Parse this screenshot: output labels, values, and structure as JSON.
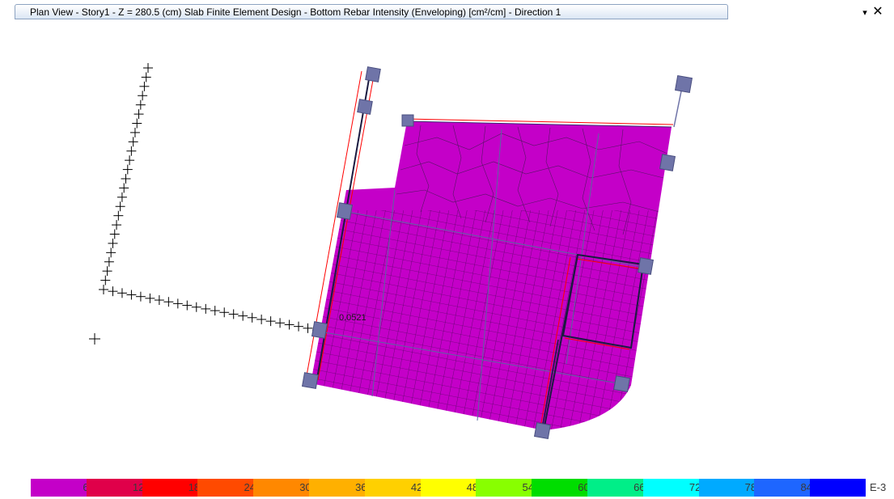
{
  "window": {
    "title": "Plan View - Story1 - Z = 280.5 (cm)  Slab Finite Element Design - Bottom Rebar Intensity (Enveloping) [cm²/cm] - Direction 1",
    "dropdown_icon": "chevron-down-icon",
    "close_icon": "close-icon",
    "close_label": "✕",
    "dropdown_label": "▾"
  },
  "plot": {
    "annotation_value": "0.0521",
    "slab_color": "#cc00cc",
    "outline_color": "#ff0000",
    "support_color": "#6f74a8"
  },
  "legend": {
    "unit": "E-3",
    "ticks": [
      "60",
      "120",
      "180",
      "240",
      "300",
      "360",
      "420",
      "480",
      "540",
      "600",
      "660",
      "720",
      "780",
      "840"
    ],
    "colors": [
      "#c400c8",
      "#e0004a",
      "#ff0000",
      "#ff4a00",
      "#ff8800",
      "#ffb000",
      "#ffd000",
      "#ffff00",
      "#88ff00",
      "#00dd00",
      "#00ee88",
      "#00ffff",
      "#00aaff",
      "#1e66ff",
      "#0000ff"
    ]
  }
}
